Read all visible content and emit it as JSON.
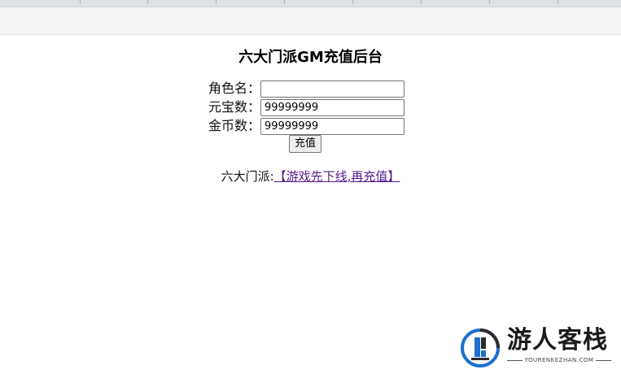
{
  "page": {
    "title": "六大门派GM充值后台"
  },
  "form": {
    "role_label": "角色名：",
    "role_value": "",
    "yuanbao_label": "元宝数：",
    "yuanbao_value": "99999999",
    "gold_label": "金币数：",
    "gold_value": "99999999",
    "submit_label": "充值"
  },
  "notice": {
    "prefix": "六大门派:",
    "link_text": "【游戏先下线,再充值】"
  },
  "watermark": {
    "name": "游人客栈",
    "url": "YOURENKEZHAN.COM"
  },
  "colors": {
    "link_visited": "#551a8b",
    "watermark_blue": "#1e6fd0",
    "chrome_tabstrip": "#dfe1e6",
    "chrome_toolbar": "#f3f4f6"
  }
}
